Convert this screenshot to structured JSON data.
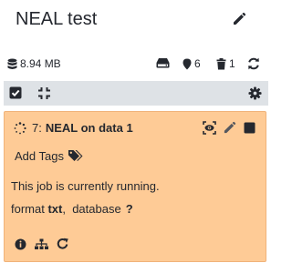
{
  "history": {
    "title": "NEAL test",
    "size": "8.94 MB",
    "shown_count": "6",
    "deleted_count": "1"
  },
  "dataset": {
    "hid": "7:",
    "name": "NEAL on data 1",
    "state": "running",
    "add_tags_label": "Add Tags",
    "status_message": "This job is currently running.",
    "format_label": "format",
    "format_value": "txt",
    "database_label": "database",
    "database_value": "?",
    "background_color": "#fecb96"
  },
  "icons": {
    "edit": "pencil-icon",
    "size": "database-icon",
    "storage": "hdd-icon",
    "shown": "map-marker-icon",
    "deleted": "trash-icon",
    "refresh": "sync-icon",
    "select_all": "check-square-icon",
    "collapse": "compress-icon",
    "settings": "gear-icon",
    "spinner": "spinner-icon",
    "view": "eye-icon",
    "delete": "stop-icon",
    "tags": "tags-icon",
    "info": "info-circle-icon",
    "related": "sitemap-icon",
    "rerun": "redo-icon"
  }
}
